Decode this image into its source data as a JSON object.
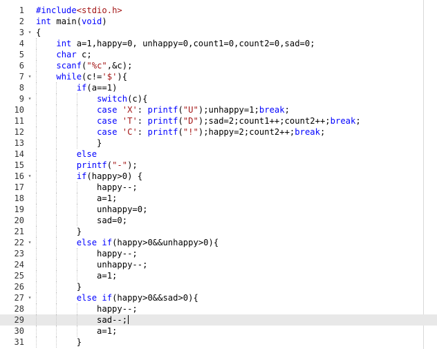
{
  "editor": {
    "active_line": 29,
    "colors": {
      "keyword": "#0000ff",
      "string": "#a31515",
      "text": "#000000",
      "line_number": "#333333",
      "active_line_bg": "#e8e8e8"
    },
    "fold_icon": "chevron-down-icon",
    "lines": [
      {
        "n": "1",
        "fold": "",
        "indent": 0
      },
      {
        "n": "2",
        "fold": "",
        "indent": 0
      },
      {
        "n": "3",
        "fold": "▾",
        "indent": 0
      },
      {
        "n": "4",
        "fold": "",
        "indent": 1
      },
      {
        "n": "5",
        "fold": "",
        "indent": 1
      },
      {
        "n": "6",
        "fold": "",
        "indent": 1
      },
      {
        "n": "7",
        "fold": "▾",
        "indent": 1
      },
      {
        "n": "8",
        "fold": "",
        "indent": 2
      },
      {
        "n": "9",
        "fold": "▾",
        "indent": 3
      },
      {
        "n": "10",
        "fold": "",
        "indent": 3
      },
      {
        "n": "11",
        "fold": "",
        "indent": 3
      },
      {
        "n": "12",
        "fold": "",
        "indent": 3
      },
      {
        "n": "13",
        "fold": "",
        "indent": 3
      },
      {
        "n": "14",
        "fold": "",
        "indent": 2
      },
      {
        "n": "15",
        "fold": "",
        "indent": 2
      },
      {
        "n": "16",
        "fold": "▾",
        "indent": 2
      },
      {
        "n": "17",
        "fold": "",
        "indent": 3
      },
      {
        "n": "18",
        "fold": "",
        "indent": 3
      },
      {
        "n": "19",
        "fold": "",
        "indent": 3
      },
      {
        "n": "20",
        "fold": "",
        "indent": 3
      },
      {
        "n": "21",
        "fold": "",
        "indent": 2
      },
      {
        "n": "22",
        "fold": "▾",
        "indent": 2
      },
      {
        "n": "23",
        "fold": "",
        "indent": 3
      },
      {
        "n": "24",
        "fold": "",
        "indent": 3
      },
      {
        "n": "25",
        "fold": "",
        "indent": 3
      },
      {
        "n": "26",
        "fold": "",
        "indent": 2
      },
      {
        "n": "27",
        "fold": "▾",
        "indent": 2
      },
      {
        "n": "28",
        "fold": "",
        "indent": 3
      },
      {
        "n": "29",
        "fold": "",
        "indent": 3
      },
      {
        "n": "30",
        "fold": "",
        "indent": 3
      },
      {
        "n": "31",
        "fold": "",
        "indent": 2
      }
    ],
    "code": [
      [
        {
          "t": "#include",
          "c": "kw"
        },
        {
          "t": "<stdio.h>",
          "c": "inc"
        }
      ],
      [
        {
          "t": "int",
          "c": "kw"
        },
        {
          "t": " main(",
          "c": ""
        },
        {
          "t": "void",
          "c": "kw"
        },
        {
          "t": ")",
          "c": ""
        }
      ],
      [
        {
          "t": "{",
          "c": ""
        }
      ],
      [
        {
          "t": "    ",
          "c": ""
        },
        {
          "t": "int",
          "c": "kw"
        },
        {
          "t": " a=1,happy=0, unhappy=0,count1=0,count2=0,sad=0;",
          "c": ""
        }
      ],
      [
        {
          "t": "    ",
          "c": ""
        },
        {
          "t": "char",
          "c": "kw"
        },
        {
          "t": " c;",
          "c": ""
        }
      ],
      [
        {
          "t": "    ",
          "c": ""
        },
        {
          "t": "scanf",
          "c": "kw"
        },
        {
          "t": "(",
          "c": ""
        },
        {
          "t": "\"%c\"",
          "c": "str"
        },
        {
          "t": ",&c);",
          "c": ""
        }
      ],
      [
        {
          "t": "    ",
          "c": ""
        },
        {
          "t": "while",
          "c": "kw"
        },
        {
          "t": "(c!=",
          "c": ""
        },
        {
          "t": "'$'",
          "c": "str"
        },
        {
          "t": "){",
          "c": ""
        }
      ],
      [
        {
          "t": "        ",
          "c": ""
        },
        {
          "t": "if",
          "c": "kw"
        },
        {
          "t": "(a==1)",
          "c": ""
        }
      ],
      [
        {
          "t": "            ",
          "c": ""
        },
        {
          "t": "switch",
          "c": "kw"
        },
        {
          "t": "(c){",
          "c": ""
        }
      ],
      [
        {
          "t": "            ",
          "c": ""
        },
        {
          "t": "case",
          "c": "kw"
        },
        {
          "t": " ",
          "c": ""
        },
        {
          "t": "'X'",
          "c": "str"
        },
        {
          "t": ": ",
          "c": ""
        },
        {
          "t": "printf",
          "c": "kw"
        },
        {
          "t": "(",
          "c": ""
        },
        {
          "t": "\"U\"",
          "c": "str"
        },
        {
          "t": ");unhappy=1;",
          "c": ""
        },
        {
          "t": "break",
          "c": "kw"
        },
        {
          "t": ";",
          "c": ""
        }
      ],
      [
        {
          "t": "            ",
          "c": ""
        },
        {
          "t": "case",
          "c": "kw"
        },
        {
          "t": " ",
          "c": ""
        },
        {
          "t": "'T'",
          "c": "str"
        },
        {
          "t": ": ",
          "c": ""
        },
        {
          "t": "printf",
          "c": "kw"
        },
        {
          "t": "(",
          "c": ""
        },
        {
          "t": "\"D\"",
          "c": "str"
        },
        {
          "t": ");sad=2;count1++;count2++;",
          "c": ""
        },
        {
          "t": "break",
          "c": "kw"
        },
        {
          "t": ";",
          "c": ""
        }
      ],
      [
        {
          "t": "            ",
          "c": ""
        },
        {
          "t": "case",
          "c": "kw"
        },
        {
          "t": " ",
          "c": ""
        },
        {
          "t": "'C'",
          "c": "str"
        },
        {
          "t": ": ",
          "c": ""
        },
        {
          "t": "printf",
          "c": "kw"
        },
        {
          "t": "(",
          "c": ""
        },
        {
          "t": "\"!\"",
          "c": "str"
        },
        {
          "t": ");happy=2;count2++;",
          "c": ""
        },
        {
          "t": "break",
          "c": "kw"
        },
        {
          "t": ";",
          "c": ""
        }
      ],
      [
        {
          "t": "            }",
          "c": ""
        }
      ],
      [
        {
          "t": "        ",
          "c": ""
        },
        {
          "t": "else",
          "c": "kw"
        }
      ],
      [
        {
          "t": "        ",
          "c": ""
        },
        {
          "t": "printf",
          "c": "kw"
        },
        {
          "t": "(",
          "c": ""
        },
        {
          "t": "\"-\"",
          "c": "str"
        },
        {
          "t": ");",
          "c": ""
        }
      ],
      [
        {
          "t": "        ",
          "c": ""
        },
        {
          "t": "if",
          "c": "kw"
        },
        {
          "t": "(happy>0) {",
          "c": ""
        }
      ],
      [
        {
          "t": "            happy--;",
          "c": ""
        }
      ],
      [
        {
          "t": "            a=1;",
          "c": ""
        }
      ],
      [
        {
          "t": "            unhappy=0;",
          "c": ""
        }
      ],
      [
        {
          "t": "            sad=0;",
          "c": ""
        }
      ],
      [
        {
          "t": "        }",
          "c": ""
        }
      ],
      [
        {
          "t": "        ",
          "c": ""
        },
        {
          "t": "else if",
          "c": "kw"
        },
        {
          "t": "(happy>0&&unhappy>0){",
          "c": ""
        }
      ],
      [
        {
          "t": "            happy--;",
          "c": ""
        }
      ],
      [
        {
          "t": "            unhappy--;",
          "c": ""
        }
      ],
      [
        {
          "t": "            a=1;",
          "c": ""
        }
      ],
      [
        {
          "t": "        }",
          "c": ""
        }
      ],
      [
        {
          "t": "        ",
          "c": ""
        },
        {
          "t": "else if",
          "c": "kw"
        },
        {
          "t": "(happy>0&&sad>0){",
          "c": ""
        }
      ],
      [
        {
          "t": "            happy--;",
          "c": ""
        }
      ],
      [
        {
          "t": "            sad--;",
          "c": ""
        }
      ],
      [
        {
          "t": "            a=1;",
          "c": ""
        }
      ],
      [
        {
          "t": "        }",
          "c": ""
        }
      ]
    ]
  }
}
